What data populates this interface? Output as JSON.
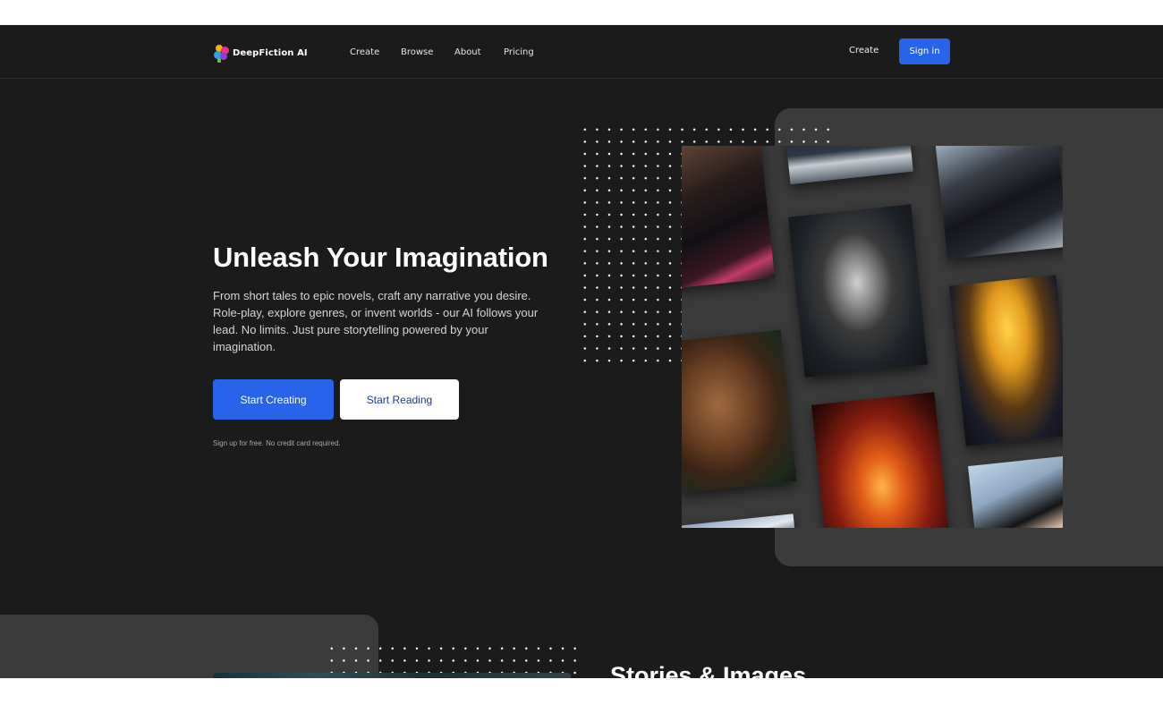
{
  "nav": {
    "brand": "DeepFiction AI",
    "links": [
      "Create",
      "Browse",
      "About",
      "Pricing"
    ],
    "right_create": "Create",
    "sign_in": "Sign in"
  },
  "hero": {
    "title": "Unleash Your Imagination",
    "description": "From short tales to epic novels, craft any narrative you desire. Role-play, explore genres, or invent worlds - our AI follows your lead. No limits. Just pure storytelling powered by your imagination.",
    "primary_button": "Start Creating",
    "secondary_button": "Start Reading",
    "note": "Sign up for free. No credit card required."
  },
  "section2": {
    "title": "Stories & Images"
  },
  "colors": {
    "accent": "#2864ea",
    "background": "#1b1b1c",
    "panel": "#3b3b3c"
  }
}
